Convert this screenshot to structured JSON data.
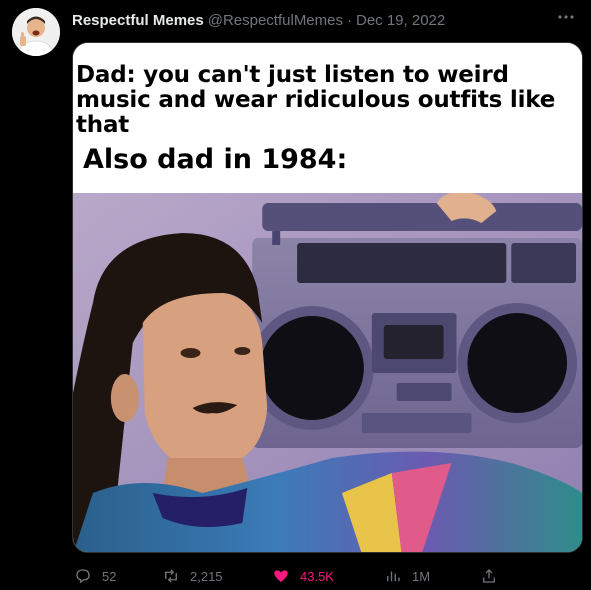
{
  "author": {
    "display_name": "Respectful Memes",
    "handle": "@RespectfulMemes",
    "separator": "·",
    "date": "Dec 19, 2022"
  },
  "meme": {
    "caption_line1": "Dad: you can't just listen to weird music and wear ridiculous outfits like that",
    "caption_line2": "Also dad in 1984:"
  },
  "metrics": {
    "replies": "52",
    "retweets": "2,215",
    "likes": "43.5K",
    "views": "1M"
  },
  "colors": {
    "background": "#000000",
    "text_primary": "#e7e9ea",
    "text_secondary": "#71767b",
    "like_active": "#f91880"
  },
  "icons": {
    "more": "more-icon",
    "reply": "reply-icon",
    "retweet": "retweet-icon",
    "like": "heart-icon",
    "views": "views-icon",
    "share": "share-icon"
  }
}
